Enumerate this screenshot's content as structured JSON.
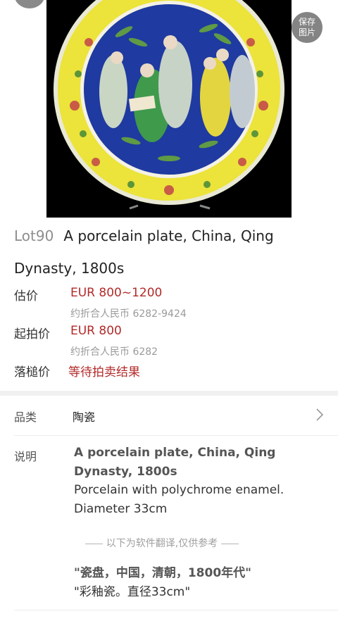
{
  "header": {
    "save_label_line1": "保存",
    "save_label_line2": "图片"
  },
  "lot": {
    "number": "Lot90",
    "title_line1": "A porcelain plate, China, Qing",
    "title_line2": "Dynasty, 1800s"
  },
  "pricing": {
    "estimate_label": "估价",
    "estimate_value": "EUR 800~1200",
    "estimate_rmb": "约折合人民币 6282-9424",
    "start_label": "起拍价",
    "start_value": "EUR 800",
    "start_rmb": "约折合人民币 6282",
    "hammer_label": "落槌价",
    "hammer_value": "等待拍卖结果"
  },
  "category": {
    "label": "品类",
    "value": "陶瓷"
  },
  "description": {
    "label": "说明",
    "title": "A porcelain plate, China, Qing Dynasty, 1800s",
    "body_line1": "Porcelain with polychrome enamel.",
    "body_line2": "Diameter 33cm",
    "translation_note": "以下为软件翻译,仅供参考",
    "translation_title": "\"瓷盘，中国，清朝，1800年代\"",
    "translation_body": "\"彩釉瓷。直径33cm\""
  },
  "colors": {
    "price_red": "#b32a2a",
    "muted_gray": "#9a9a9a"
  }
}
